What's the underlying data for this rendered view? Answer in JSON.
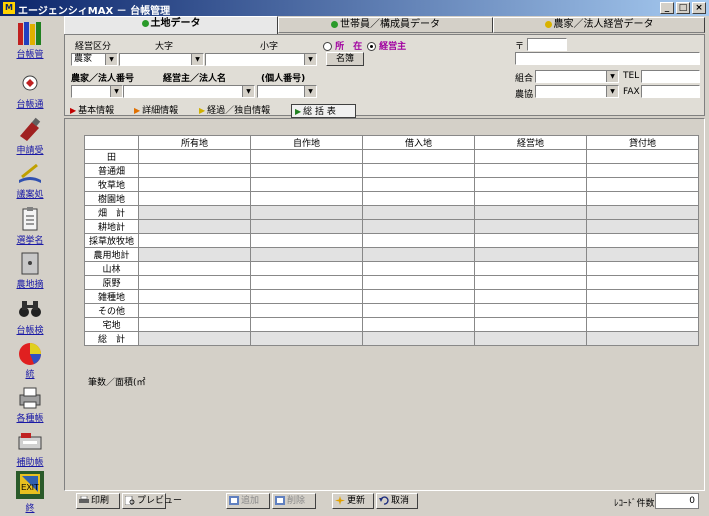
{
  "window": {
    "title": "エージェンシィMAX － 台帳管理",
    "minimize": "_",
    "maximize": "□",
    "close": "×"
  },
  "sidebar": {
    "items": [
      {
        "label": "台帳管",
        "icon": "ledger-books-icon"
      },
      {
        "label": "台帳通",
        "icon": "notice-icon"
      },
      {
        "label": "申請受",
        "icon": "application-icon"
      },
      {
        "label": "議案処",
        "icon": "agenda-icon"
      },
      {
        "label": "選挙名",
        "icon": "election-list-icon"
      },
      {
        "label": "農地摘",
        "icon": "farmland-icon"
      },
      {
        "label": "台帳検",
        "icon": "binoculars-search-icon"
      },
      {
        "label": "統",
        "icon": "pie-chart-icon"
      },
      {
        "label": "各種帳",
        "icon": "printer-icon"
      },
      {
        "label": "補助帳",
        "icon": "support-icon"
      },
      {
        "label": "終",
        "icon": "exit-icon"
      }
    ]
  },
  "tabs": [
    {
      "label": "土地データ",
      "dot": "#2a9a2a"
    },
    {
      "label": "世帯員／構成員データ",
      "dot": "#2a9a2a"
    },
    {
      "label": "農家／法人経営データ",
      "dot": "#d9b200"
    }
  ],
  "form": {
    "keiei_kubun_label": "経営区分",
    "oaza_label": "大字",
    "koaza_label": "小字",
    "radio_shozai": "所　在",
    "radio_keieinushi": "経営主",
    "meibo_button": "名簿",
    "keiei_kubun_value": "農家",
    "farm_number_label": "農家／法人番号",
    "owner_label": "経営主／法人名",
    "personal_number_label": "(個人番号)",
    "postal_mark": "〒",
    "kumiai_label": "組合",
    "nokyo_label": "農協",
    "tel_label": "TEL",
    "fax_label": "FAX"
  },
  "subtabs": [
    "基本情報",
    "詳細情報",
    "経過／独自情報",
    "総 括 表"
  ],
  "table": {
    "columns": [
      "所有地",
      "自作地",
      "借入地",
      "経営地",
      "貸付地"
    ],
    "rows": [
      "田",
      "普通畑",
      "牧草地",
      "樹園地",
      "畑　計",
      "耕地計",
      "採草放牧地",
      "農用地計",
      "山林",
      "原野",
      "雑種地",
      "その他",
      "宅地",
      "総　計"
    ]
  },
  "caption": "筆数／面積(㎡",
  "toolbar": {
    "print": "印刷",
    "preview": "プレビュー",
    "append": "追加",
    "delete": "削除",
    "update": "更新",
    "cancel": "取消",
    "record_count_label": "ﾚｺｰﾄﾞ件数",
    "record_count": "0"
  }
}
